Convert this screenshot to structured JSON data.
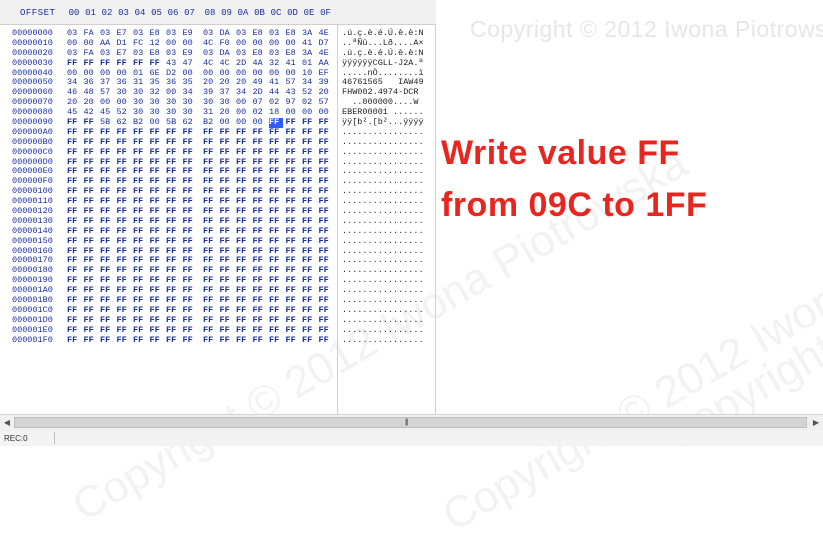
{
  "header": {
    "offset_label": "OFFSET",
    "hex_columns": [
      "00",
      "01",
      "02",
      "03",
      "04",
      "05",
      "06",
      "07",
      "08",
      "09",
      "0A",
      "0B",
      "0C",
      "0D",
      "0E",
      "0F"
    ]
  },
  "watermark": "Copyright © 2012 Iwona Piotrowska",
  "annotation": {
    "line1": "Write value FF",
    "line2": "from 09C to 1FF"
  },
  "selection": {
    "row": 9,
    "col": 12
  },
  "rows": [
    {
      "offset": "00000000",
      "hex": [
        "03",
        "FA",
        "03",
        "E7",
        "03",
        "E8",
        "03",
        "E9",
        "03",
        "DA",
        "03",
        "E8",
        "03",
        "E8",
        "3A",
        "4E"
      ],
      "ascii": ".ú.ç.è.é.Ú.è.è:N"
    },
    {
      "offset": "00000010",
      "hex": [
        "00",
        "00",
        "AA",
        "D1",
        "FC",
        "12",
        "00",
        "00",
        "4C",
        "F0",
        "00",
        "00",
        "00",
        "00",
        "41",
        "D7"
      ],
      "ascii": "..ªÑü...Lð....A×"
    },
    {
      "offset": "00000020",
      "hex": [
        "03",
        "FA",
        "03",
        "E7",
        "03",
        "E8",
        "03",
        "E9",
        "03",
        "DA",
        "03",
        "E8",
        "03",
        "E8",
        "3A",
        "4E"
      ],
      "ascii": ".ú.ç.è.é.Ú.è.è:N"
    },
    {
      "offset": "00000030",
      "hex": [
        "FF",
        "FF",
        "FF",
        "FF",
        "FF",
        "FF",
        "43",
        "47",
        "4C",
        "4C",
        "2D",
        "4A",
        "32",
        "41",
        "01",
        "AA"
      ],
      "ascii": "ÿÿÿÿÿÿCGLL-J2A.ª"
    },
    {
      "offset": "00000040",
      "hex": [
        "00",
        "00",
        "00",
        "00",
        "01",
        "6E",
        "D2",
        "00",
        "00",
        "00",
        "00",
        "00",
        "00",
        "00",
        "10",
        "EF"
      ],
      "ascii": ".....nÒ........ï"
    },
    {
      "offset": "00000050",
      "hex": [
        "34",
        "36",
        "37",
        "36",
        "31",
        "35",
        "36",
        "35",
        "20",
        "20",
        "20",
        "49",
        "41",
        "57",
        "34",
        "39"
      ],
      "ascii": "46761565   IAW49"
    },
    {
      "offset": "00000060",
      "hex": [
        "46",
        "48",
        "57",
        "30",
        "30",
        "32",
        "00",
        "34",
        "39",
        "37",
        "34",
        "2D",
        "44",
        "43",
        "52",
        "20"
      ],
      "ascii": "FHW002.4974-DCR "
    },
    {
      "offset": "00000070",
      "hex": [
        "20",
        "20",
        "00",
        "00",
        "30",
        "30",
        "30",
        "30",
        "30",
        "30",
        "00",
        "07",
        "02",
        "97",
        "02",
        "57"
      ],
      "ascii": "  ..000000....W"
    },
    {
      "offset": "00000080",
      "hex": [
        "45",
        "42",
        "45",
        "52",
        "30",
        "30",
        "30",
        "30",
        "31",
        "20",
        "00",
        "02",
        "18",
        "00",
        "00",
        "00"
      ],
      "ascii": "EBER00001 ......"
    },
    {
      "offset": "00000090",
      "hex": [
        "FF",
        "FF",
        "5B",
        "62",
        "B2",
        "00",
        "5B",
        "62",
        "B2",
        "00",
        "00",
        "00",
        "FF",
        "FF",
        "FF",
        "FF"
      ],
      "ascii": "ÿÿ[b².[b²...ÿÿÿÿ"
    },
    {
      "offset": "000000A0",
      "fill": "FF"
    },
    {
      "offset": "000000B0",
      "fill": "FF"
    },
    {
      "offset": "000000C0",
      "fill": "FF"
    },
    {
      "offset": "000000D0",
      "fill": "FF"
    },
    {
      "offset": "000000E0",
      "fill": "FF"
    },
    {
      "offset": "000000F0",
      "fill": "FF"
    },
    {
      "offset": "00000100",
      "fill": "FF"
    },
    {
      "offset": "00000110",
      "fill": "FF"
    },
    {
      "offset": "00000120",
      "fill": "FF"
    },
    {
      "offset": "00000130",
      "fill": "FF"
    },
    {
      "offset": "00000140",
      "fill": "FF"
    },
    {
      "offset": "00000150",
      "fill": "FF"
    },
    {
      "offset": "00000160",
      "fill": "FF"
    },
    {
      "offset": "00000170",
      "fill": "FF"
    },
    {
      "offset": "00000180",
      "fill": "FF"
    },
    {
      "offset": "00000190",
      "fill": "FF"
    },
    {
      "offset": "000001A0",
      "fill": "FF"
    },
    {
      "offset": "000001B0",
      "fill": "FF"
    },
    {
      "offset": "000001C0",
      "fill": "FF"
    },
    {
      "offset": "000001D0",
      "fill": "FF"
    },
    {
      "offset": "000001E0",
      "fill": "FF"
    },
    {
      "offset": "000001F0",
      "fill": "FF"
    }
  ],
  "fill_ascii": "................",
  "status": {
    "text": "REC:0"
  },
  "colors": {
    "hex_text": "#1b2f9e",
    "selection": "#2d5cff",
    "annotation": "#e8261f"
  }
}
